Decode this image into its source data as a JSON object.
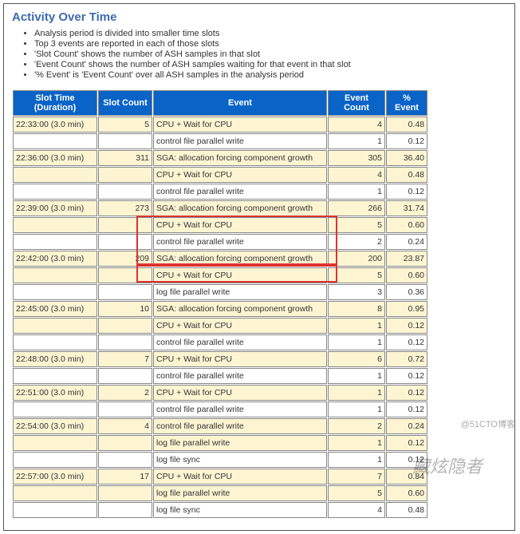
{
  "title": "Activity Over Time",
  "bullets": [
    "Analysis period is divided into smaller time slots",
    "Top 3 events are reported in each of those slots",
    "'Slot Count' shows the number of ASH samples in that slot",
    "'Event Count' shows the number of ASH samples waiting for that event in that slot",
    "'% Event' is 'Event Count' over all ASH samples in the analysis period"
  ],
  "headers": {
    "slot_time": "Slot Time (Duration)",
    "slot_count": "Slot Count",
    "event": "Event",
    "event_count": "Event Count",
    "pct_event": "% Event"
  },
  "rows": [
    {
      "st": "22:33:00 (3.0 min)",
      "sc": "5",
      "ev": "CPU + Wait for CPU",
      "ec": "4",
      "pe": "0.48",
      "y": true
    },
    {
      "st": "",
      "sc": "",
      "ev": "control file parallel write",
      "ec": "1",
      "pe": "0.12",
      "y": false
    },
    {
      "st": "22:36:00 (3.0 min)",
      "sc": "311",
      "ev": "SGA: allocation forcing component growth",
      "ec": "305",
      "pe": "36.40",
      "y": true
    },
    {
      "st": "",
      "sc": "",
      "ev": "CPU + Wait for CPU",
      "ec": "4",
      "pe": "0.48",
      "y": true
    },
    {
      "st": "",
      "sc": "",
      "ev": "control file parallel write",
      "ec": "1",
      "pe": "0.12",
      "y": false
    },
    {
      "st": "22:39:00 (3.0 min)",
      "sc": "273",
      "ev": "SGA: allocation forcing component growth",
      "ec": "266",
      "pe": "31.74",
      "y": true
    },
    {
      "st": "",
      "sc": "",
      "ev": "CPU + Wait for CPU",
      "ec": "5",
      "pe": "0.60",
      "y": true
    },
    {
      "st": "",
      "sc": "",
      "ev": "control file parallel write",
      "ec": "2",
      "pe": "0.24",
      "y": false
    },
    {
      "st": "22:42:00 (3.0 min)",
      "sc": "209",
      "ev": "SGA: allocation forcing component growth",
      "ec": "200",
      "pe": "23.87",
      "y": true
    },
    {
      "st": "",
      "sc": "",
      "ev": "CPU + Wait for CPU",
      "ec": "5",
      "pe": "0.60",
      "y": true
    },
    {
      "st": "",
      "sc": "",
      "ev": "log file parallel write",
      "ec": "3",
      "pe": "0.36",
      "y": false
    },
    {
      "st": "22:45:00 (3.0 min)",
      "sc": "10",
      "ev": "SGA: allocation forcing component growth",
      "ec": "8",
      "pe": "0.95",
      "y": true
    },
    {
      "st": "",
      "sc": "",
      "ev": "CPU + Wait for CPU",
      "ec": "1",
      "pe": "0.12",
      "y": true
    },
    {
      "st": "",
      "sc": "",
      "ev": "control file parallel write",
      "ec": "1",
      "pe": "0.12",
      "y": false
    },
    {
      "st": "22:48:00 (3.0 min)",
      "sc": "7",
      "ev": "CPU + Wait for CPU",
      "ec": "6",
      "pe": "0.72",
      "y": true
    },
    {
      "st": "",
      "sc": "",
      "ev": "control file parallel write",
      "ec": "1",
      "pe": "0.12",
      "y": false
    },
    {
      "st": "22:51:00 (3.0 min)",
      "sc": "2",
      "ev": "CPU + Wait for CPU",
      "ec": "1",
      "pe": "0.12",
      "y": true
    },
    {
      "st": "",
      "sc": "",
      "ev": "control file parallel write",
      "ec": "1",
      "pe": "0.12",
      "y": false
    },
    {
      "st": "22:54:00 (3.0 min)",
      "sc": "4",
      "ev": "control file parallel write",
      "ec": "2",
      "pe": "0.24",
      "y": true
    },
    {
      "st": "",
      "sc": "",
      "ev": "log file parallel write",
      "ec": "1",
      "pe": "0.12",
      "y": true
    },
    {
      "st": "",
      "sc": "",
      "ev": "log file sync",
      "ec": "1",
      "pe": "0.12",
      "y": false
    },
    {
      "st": "22:57:00 (3.0 min)",
      "sc": "17",
      "ev": "CPU + Wait for CPU",
      "ec": "7",
      "pe": "0.84",
      "y": true
    },
    {
      "st": "",
      "sc": "",
      "ev": "log file parallel write",
      "ec": "5",
      "pe": "0.60",
      "y": true
    },
    {
      "st": "",
      "sc": "",
      "ev": "log file sync",
      "ec": "4",
      "pe": "0.48",
      "y": false
    }
  ],
  "watermark": "藏炫隐者",
  "credit": "@51CTO博客"
}
